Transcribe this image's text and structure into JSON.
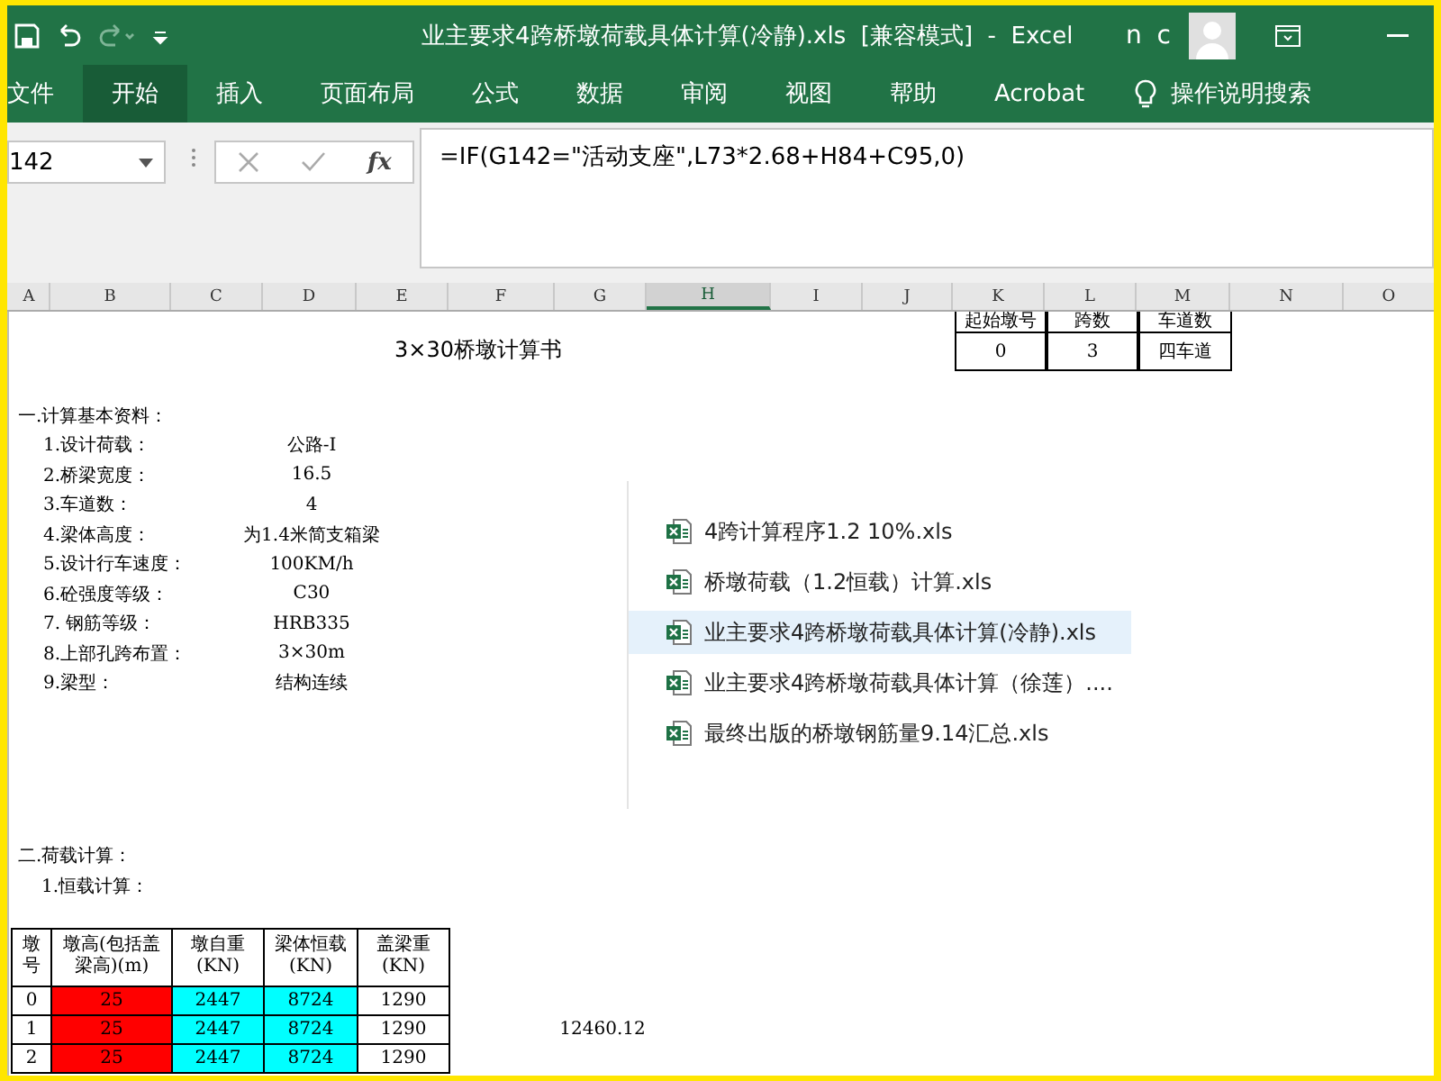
{
  "window": {
    "title": "业主要求4跨桥墩荷载具体计算(冷静).xls  [兼容模式]  -  Excel",
    "user": "n c"
  },
  "ribbon_tabs": [
    {
      "label": "文件",
      "selected": false
    },
    {
      "label": "开始",
      "selected": true
    },
    {
      "label": "插入",
      "selected": false
    },
    {
      "label": "页面布局",
      "selected": false
    },
    {
      "label": "公式",
      "selected": false
    },
    {
      "label": "数据",
      "selected": false
    },
    {
      "label": "审阅",
      "selected": false
    },
    {
      "label": "视图",
      "selected": false
    },
    {
      "label": "帮助",
      "selected": false
    },
    {
      "label": "Acrobat",
      "selected": false
    }
  ],
  "tell_me": "操作说明搜索",
  "formula_bar": {
    "name_box": "142",
    "fx": "fx",
    "formula": "=IF(G142=\"活动支座\",L73*2.68+H84+C95,0)"
  },
  "columns": [
    {
      "label": "A",
      "selected": false
    },
    {
      "label": "B",
      "selected": false
    },
    {
      "label": "C",
      "selected": false
    },
    {
      "label": "D",
      "selected": false
    },
    {
      "label": "E",
      "selected": false
    },
    {
      "label": "F",
      "selected": false
    },
    {
      "label": "G",
      "selected": false
    },
    {
      "label": "H",
      "selected": true
    },
    {
      "label": "I",
      "selected": false
    },
    {
      "label": "J",
      "selected": false
    },
    {
      "label": "K",
      "selected": false
    },
    {
      "label": "L",
      "selected": false
    },
    {
      "label": "M",
      "selected": false
    },
    {
      "label": "N",
      "selected": false
    },
    {
      "label": "O",
      "selected": false
    }
  ],
  "sheet": {
    "title": "3×30桥墩计算书",
    "summary_table": {
      "headers": [
        "起始墩号",
        "跨数",
        "车道数"
      ],
      "values": [
        "0",
        "3",
        "四车道"
      ]
    },
    "section_1": "一.计算基本资料：",
    "params": [
      {
        "label": "1.设计荷载：",
        "value": "公路-I"
      },
      {
        "label": "2.桥梁宽度：",
        "value": "16.5"
      },
      {
        "label": "3.车道数：",
        "value": "4"
      },
      {
        "label": "4.梁体高度：",
        "value": "为1.4米简支箱梁"
      },
      {
        "label": "5.设计行车速度：",
        "value": "100KM/h"
      },
      {
        "label": "6.砼强度等级：",
        "value": "C30"
      },
      {
        "label": "7.  钢筋等级：",
        "value": "HRB335"
      },
      {
        "label": "8.上部孔跨布置：",
        "value": "3×30m"
      },
      {
        "label": "9.梁型：",
        "value": "结构连续"
      }
    ],
    "section_2": "二.荷载计算：",
    "subsection": "1.恒载计算：",
    "pier_table": {
      "columns": [
        {
          "label": "墩号",
          "color": "#ffffff"
        },
        {
          "label": "墩高(包括盖梁高)(m)",
          "color": "#ff0000"
        },
        {
          "label": "墩自重(KN)",
          "color": "#00ffff"
        },
        {
          "label": "梁体恒载(KN)",
          "color": "#00ffff"
        },
        {
          "label": "盖梁重(KN)",
          "color": "#ffffff"
        }
      ],
      "rows": [
        [
          "0",
          "25",
          "2447",
          "8724",
          "1290"
        ],
        [
          "1",
          "25",
          "2447",
          "8724",
          "1290"
        ],
        [
          "2",
          "25",
          "2447",
          "8724",
          "1290"
        ]
      ]
    },
    "side_value": "12460.12"
  },
  "recent_files": [
    {
      "name": "4跨计算程序1.2 10%.xls",
      "selected": false
    },
    {
      "name": "桥墩荷载（1.2恒载）计算.xls",
      "selected": false
    },
    {
      "name": "业主要求4跨桥墩荷载具体计算(冷静).xls",
      "selected": true
    },
    {
      "name": "业主要求4跨桥墩荷载具体计算（徐莲）....",
      "selected": false
    },
    {
      "name": "最终出版的桥墩钢筋量9.14汇总.xls",
      "selected": false
    }
  ]
}
